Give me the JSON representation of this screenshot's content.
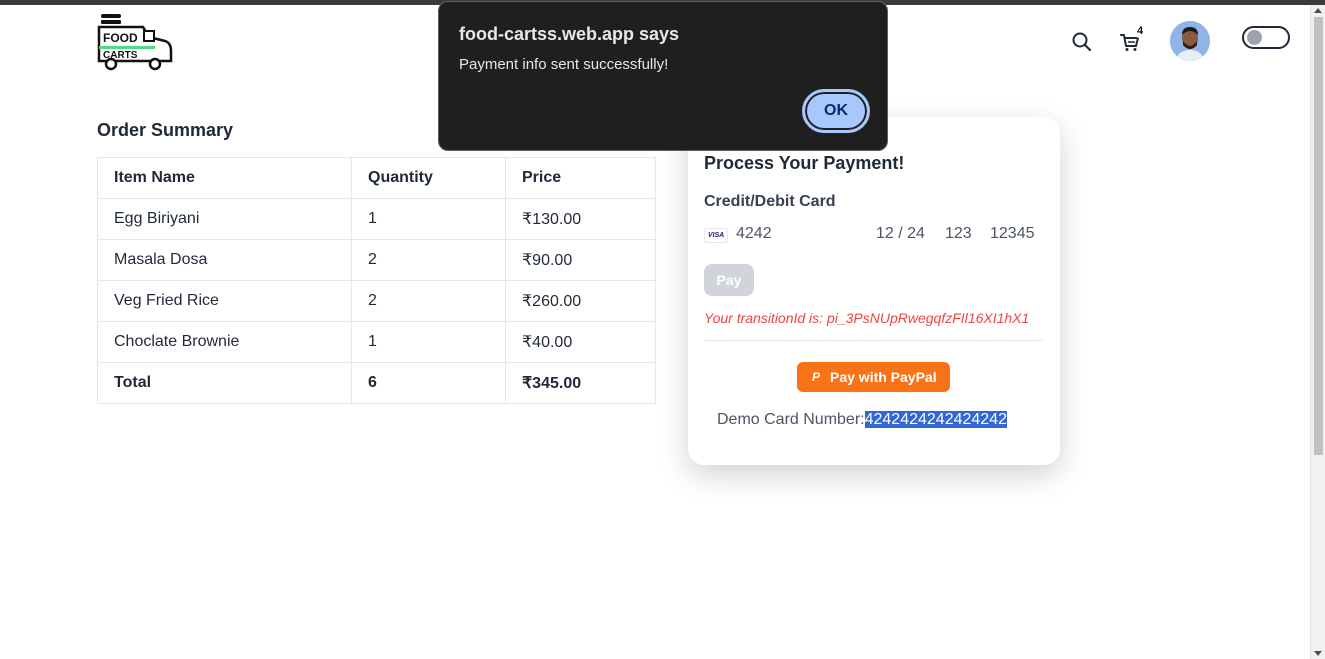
{
  "brand": {
    "logo_text_top": "FOOD",
    "logo_text_bottom": "CARTS"
  },
  "nav": {
    "cart_count": "4",
    "icons": [
      "search-icon",
      "cart-icon"
    ]
  },
  "order_summary": {
    "title": "Order Summary",
    "headers": [
      "Item Name",
      "Quantity",
      "Price"
    ],
    "rows": [
      {
        "name": "Egg Biriyani",
        "qty": "1",
        "price": "₹130.00"
      },
      {
        "name": "Masala Dosa",
        "qty": "2",
        "price": "₹90.00"
      },
      {
        "name": "Veg Fried Rice",
        "qty": "2",
        "price": "₹260.00"
      },
      {
        "name": "Choclate Brownie",
        "qty": "1",
        "price": "₹40.00"
      }
    ],
    "total": {
      "label": "Total",
      "qty": "6",
      "price": "₹345.00"
    }
  },
  "payment": {
    "title": "Process Your Payment!",
    "card_label": "Credit/Debit Card",
    "card_brand": "VISA",
    "card_number": "4242",
    "expiry": "12 / 24",
    "cvc": "123",
    "zip": "12345",
    "pay_label": "Pay",
    "transaction_text": "Your transitionId is: pi_3PsNUpRwegqfzFIl16XI1hX1",
    "paypal_label": "Pay with PayPal",
    "demo_label": "Demo Card Number:",
    "demo_number": "4242424242424242"
  },
  "dialog": {
    "title": "food-cartss.web.app says",
    "message": "Payment info sent successfully!",
    "ok_label": "OK"
  },
  "colors": {
    "accent": "#f97316",
    "error": "#ef4444",
    "dialog_bg": "#1f1f1f",
    "ok_button": "#a8c7fa"
  }
}
